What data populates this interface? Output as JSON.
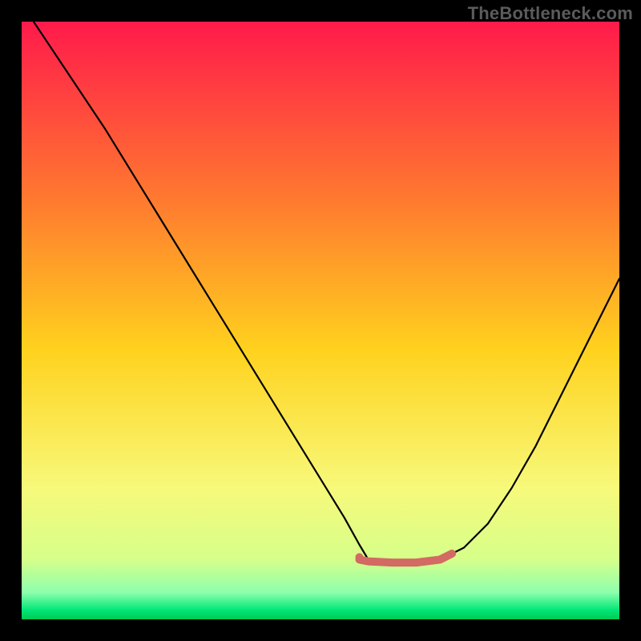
{
  "watermark": "TheBottleneck.com",
  "chart_data": {
    "type": "line",
    "title": "",
    "xlabel": "",
    "ylabel": "",
    "xlim": [
      0,
      100
    ],
    "ylim": [
      0,
      100
    ],
    "grid": false,
    "legend": false,
    "gradient_stops": [
      {
        "offset": 0.0,
        "color": "#ff1a4b"
      },
      {
        "offset": 0.3,
        "color": "#ff7a2f"
      },
      {
        "offset": 0.55,
        "color": "#ffd21e"
      },
      {
        "offset": 0.78,
        "color": "#f7f97a"
      },
      {
        "offset": 0.9,
        "color": "#d6ff8a"
      },
      {
        "offset": 0.955,
        "color": "#8dffad"
      },
      {
        "offset": 0.985,
        "color": "#00e676"
      },
      {
        "offset": 1.0,
        "color": "#00c853"
      }
    ],
    "series": [
      {
        "name": "bottleneck-curve",
        "color": "#000000",
        "stroke_width": 2.2,
        "x": [
          2,
          6,
          10,
          14,
          18,
          22,
          26,
          30,
          34,
          38,
          42,
          46,
          50,
          54,
          56.5,
          58,
          62,
          66,
          70,
          74,
          78,
          82,
          86,
          90,
          94,
          98,
          100
        ],
        "y": [
          100,
          94,
          88,
          82,
          75.5,
          69,
          62.5,
          56,
          49.5,
          43,
          36.5,
          30,
          23.5,
          17,
          12.5,
          10,
          9.5,
          9.5,
          10,
          12,
          16,
          22,
          29,
          37,
          45,
          53,
          57
        ]
      }
    ],
    "highlight": {
      "name": "flat-bottom-highlight",
      "color": "#d36a63",
      "stroke_width": 10,
      "dot_radius": 5,
      "x": [
        56.5,
        58,
        62,
        66,
        70,
        72
      ],
      "y": [
        10,
        9.7,
        9.5,
        9.5,
        10,
        11
      ]
    }
  }
}
